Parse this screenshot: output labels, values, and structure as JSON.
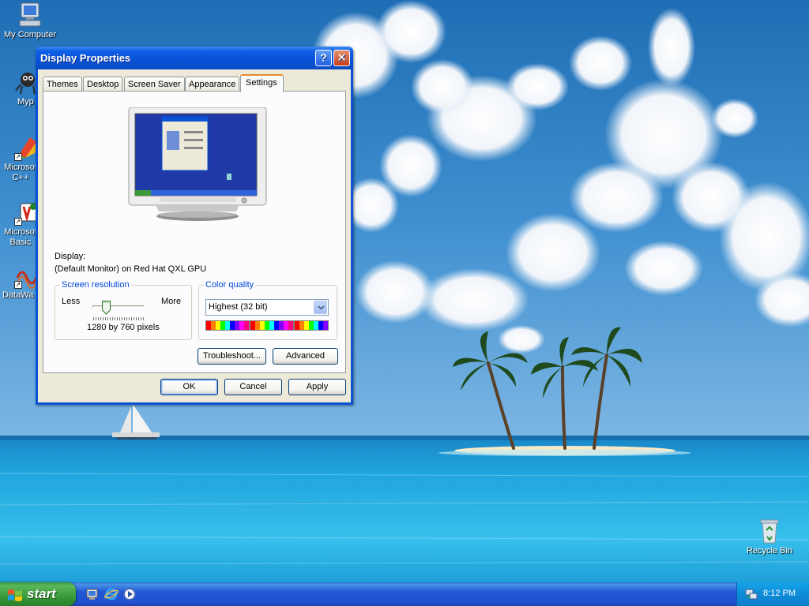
{
  "desktop": {
    "icons": [
      {
        "label": "My Computer"
      },
      {
        "label": "Myp"
      },
      {
        "label": "Microsof\nC++"
      },
      {
        "label": "Microsof\nBasic"
      },
      {
        "label": "DataWa"
      },
      {
        "label": "Recycle Bin"
      }
    ]
  },
  "dialog": {
    "title": "Display Properties",
    "help_glyph": "?",
    "close_glyph": "✕",
    "tabs": [
      "Themes",
      "Desktop",
      "Screen Saver",
      "Appearance",
      "Settings"
    ],
    "active_tab": "Settings",
    "display_label": "Display:",
    "display_value": "(Default Monitor) on Red Hat QXL GPU",
    "screen_resolution": {
      "legend": "Screen resolution",
      "less": "Less",
      "more": "More",
      "value_text": "1280 by 760 pixels",
      "slider_fraction": 0.28
    },
    "color_quality": {
      "legend": "Color quality",
      "selected": "Highest (32 bit)"
    },
    "buttons": {
      "troubleshoot": "Troubleshoot...",
      "advanced": "Advanced",
      "ok": "OK",
      "cancel": "Cancel",
      "apply": "Apply"
    }
  },
  "taskbar": {
    "start_label": "start",
    "clock": "8:12 PM"
  },
  "colors": {
    "title_blue": "#0a53d6",
    "dialog_bg": "#ece9d8",
    "tab_accent": "#e68b2c",
    "legend_blue": "#0046d5",
    "start_green": "#379b37",
    "taskbar_blue": "#2157d7",
    "tray_blue": "#0e8bd7"
  },
  "icon_names": [
    "computer-icon",
    "spider-icon",
    "msvc-icon",
    "vb-icon",
    "datawave-icon",
    "recycle-bin-icon",
    "ie-icon",
    "media-player-icon",
    "network-icon",
    "windows-flag-icon"
  ]
}
